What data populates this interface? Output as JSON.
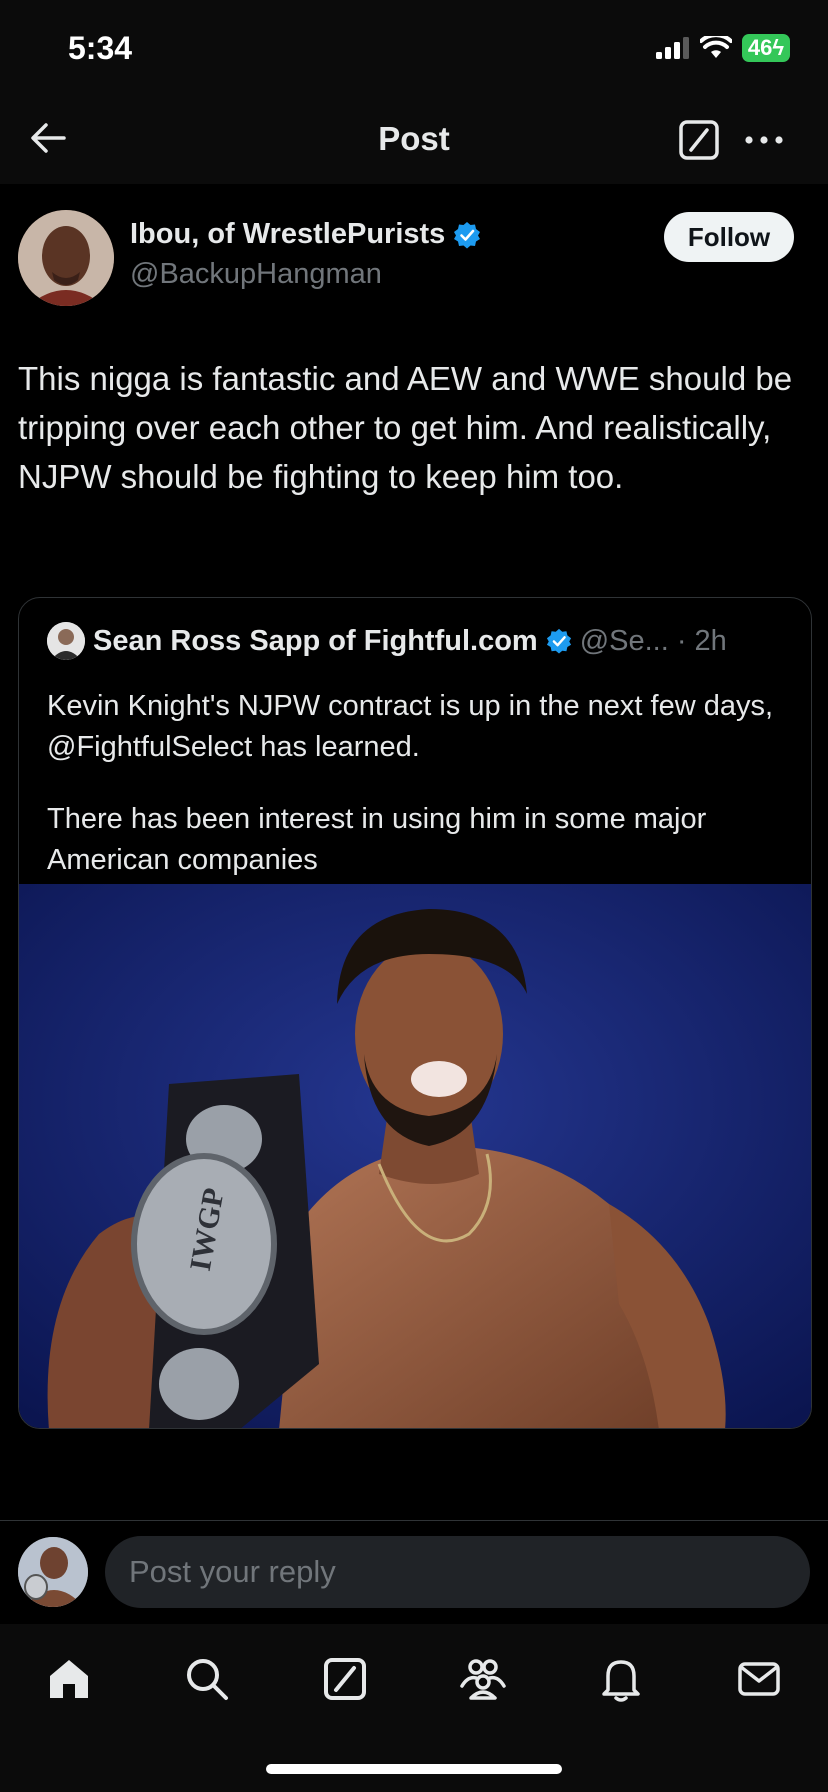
{
  "status_bar": {
    "time": "5:34",
    "battery": "46"
  },
  "header": {
    "title": "Post"
  },
  "post": {
    "author_name": "Ibou, of WrestlePurists",
    "author_handle": "@BackupHangman",
    "follow_label": "Follow",
    "text": "This nigga is fantastic and AEW and WWE should be tripping over each other to get him. And realistically, NJPW should be fighting to keep him too."
  },
  "quote": {
    "author_name": "Sean Ross Sapp of Fightful.com",
    "meta": "@Se... · 2h",
    "text_line1": "Kevin Knight's NJPW contract is up in the next few days, @FightfulSelect has learned.",
    "text_line2": "There has been interest in using him in some major American companies",
    "image_belt_text": "IWGP"
  },
  "reply": {
    "placeholder": "Post your reply"
  },
  "icons": {
    "back": "back-arrow-icon",
    "grok": "grok-icon",
    "more": "more-icon",
    "verified": "verified-badge-icon",
    "nav": [
      "home-icon",
      "search-icon",
      "grok-icon",
      "communities-icon",
      "notifications-icon",
      "messages-icon"
    ]
  },
  "colors": {
    "verified": "#1d9bf0",
    "battery": "#34c759",
    "follow_bg": "#eff3f4"
  }
}
